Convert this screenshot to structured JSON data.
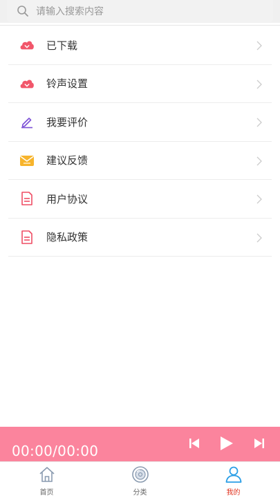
{
  "search": {
    "placeholder": "请输入搜索内容"
  },
  "menu": {
    "items": [
      {
        "label": "已下载",
        "icon": "cloud-download-icon"
      },
      {
        "label": "铃声设置",
        "icon": "cloud-bell-icon"
      },
      {
        "label": "我要评价",
        "icon": "pencil-icon"
      },
      {
        "label": "建议反馈",
        "icon": "mail-icon"
      },
      {
        "label": "用户协议",
        "icon": "document-icon"
      },
      {
        "label": "隐私政策",
        "icon": "document-icon"
      }
    ]
  },
  "player": {
    "time": "00:00/00:00"
  },
  "tabbar": {
    "tabs": [
      {
        "label": "首页",
        "icon": "home-icon"
      },
      {
        "label": "分类",
        "icon": "disc-icon"
      },
      {
        "label": "我的",
        "icon": "user-icon",
        "active": true
      }
    ]
  },
  "colors": {
    "accent": "#fb849d",
    "active_tab": "#e0331f"
  }
}
